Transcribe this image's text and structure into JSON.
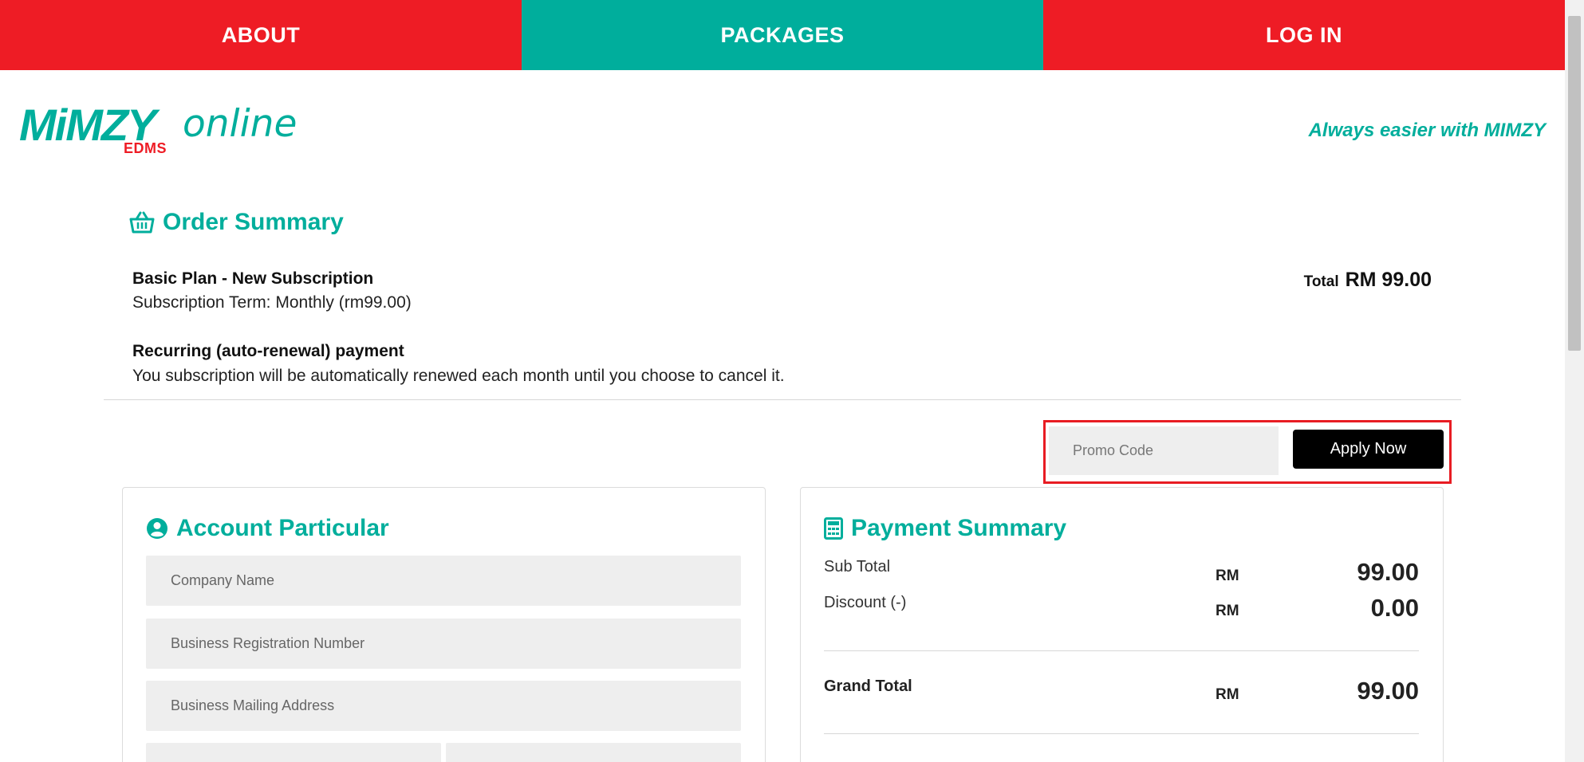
{
  "nav": {
    "about": "ABOUT",
    "packages": "PACKAGES",
    "login": "LOG IN"
  },
  "colors": {
    "brand_red": "#ee1c25",
    "brand_teal": "#00ae9c"
  },
  "header": {
    "logo_main": "MiMZY",
    "logo_online": "online",
    "logo_sub": "EDMS",
    "tagline": "Always easier with MIMZY"
  },
  "order_summary": {
    "title": "Order Summary",
    "icon": "basket-icon",
    "plan_name": "Basic Plan - New Subscription",
    "plan_term": "Subscription Term: Monthly (rm99.00)",
    "recurring_title": "Recurring (auto-renewal) payment",
    "recurring_desc": "You subscription will be automatically renewed each month until you choose to cancel it.",
    "total_label": "Total",
    "total_value": "RM 99.00"
  },
  "promo": {
    "placeholder": "Promo Code",
    "value": "",
    "button": "Apply Now"
  },
  "account": {
    "title": "Account Particular",
    "icon": "user-circle-icon",
    "fields": {
      "company_name": "Company Name",
      "business_reg": "Business Registration Number",
      "mailing_address": "Business Mailing Address"
    }
  },
  "payment": {
    "title": "Payment Summary",
    "icon": "calculator-icon",
    "subtotal_label": "Sub Total",
    "subtotal_currency": "RM",
    "subtotal_value": "99.00",
    "discount_label": "Discount (-)",
    "discount_currency": "RM",
    "discount_value": "0.00",
    "grand_label": "Grand Total",
    "grand_currency": "RM",
    "grand_value": "99.00"
  }
}
